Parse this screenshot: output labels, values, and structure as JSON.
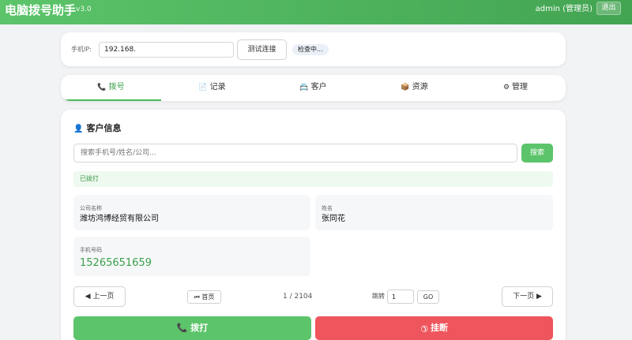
{
  "header": {
    "title": "电脑拨号助手",
    "version": "v3.0",
    "user": "admin (管理员)",
    "logout_label": "退出"
  },
  "connection": {
    "ip_label": "手机IP:",
    "ip_value": "192.168.",
    "test_button_label": "测试连接",
    "status_text": "检查中..."
  },
  "tabs": [
    {
      "icon": "phone-icon",
      "label": "拨号",
      "active": true
    },
    {
      "icon": "document-icon",
      "label": "记录",
      "active": false
    },
    {
      "icon": "contact-card-icon",
      "label": "客户",
      "active": false
    },
    {
      "icon": "box-icon",
      "label": "资源",
      "active": false
    },
    {
      "icon": "gear-icon",
      "label": "管理",
      "active": false
    }
  ],
  "customer": {
    "section_title": "客户信息",
    "search_placeholder": "搜索手机号/姓名/公司...",
    "search_button_label": "搜索",
    "dialed_status": "已拨打",
    "company_label": "公司名称",
    "company_value": "潍坊鸿博经贸有限公司",
    "name_label": "姓名",
    "name_value": "张同花",
    "phone_label": "手机号码",
    "phone_value": "15265651659"
  },
  "pagination": {
    "prev_label": "◀ 上一页",
    "first_label": "⏮ 首页",
    "page_info": "1 / 2104",
    "jump_label": "跳转",
    "jump_value": "1",
    "go_label": "GO",
    "next_label": "下一页 ▶"
  },
  "actions": {
    "call_label": "拨打",
    "hangup_label": "挂断"
  },
  "colors": {
    "accent_green": "#5cc46a",
    "danger_red": "#ef555c",
    "phone_green": "#3aa04a"
  }
}
